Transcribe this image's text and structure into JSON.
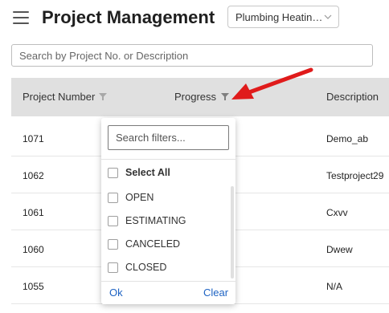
{
  "header": {
    "title": "Project Management",
    "company_select_value": "Plumbing Heating & Air"
  },
  "search": {
    "placeholder": "Search by Project No. or Description"
  },
  "table": {
    "columns": [
      "Project Number",
      "Progress",
      "Description"
    ],
    "rows": [
      {
        "number": "1071",
        "description": "Demo_ab"
      },
      {
        "number": "1062",
        "description": "Testproject29"
      },
      {
        "number": "1061",
        "description": "Cxvv"
      },
      {
        "number": "1060",
        "description": "Dwew"
      },
      {
        "number": "1055",
        "description": "N/A"
      }
    ]
  },
  "filter_popup": {
    "search_placeholder": "Search filters...",
    "select_all_label": "Select All",
    "options": [
      "OPEN",
      "ESTIMATING",
      "CANCELED",
      "CLOSED"
    ],
    "ok_label": "Ok",
    "clear_label": "Clear"
  },
  "colors": {
    "header_bg": "#e0e0e0",
    "link_blue": "#1e63c3",
    "annotation_arrow": "#e01b1b"
  }
}
